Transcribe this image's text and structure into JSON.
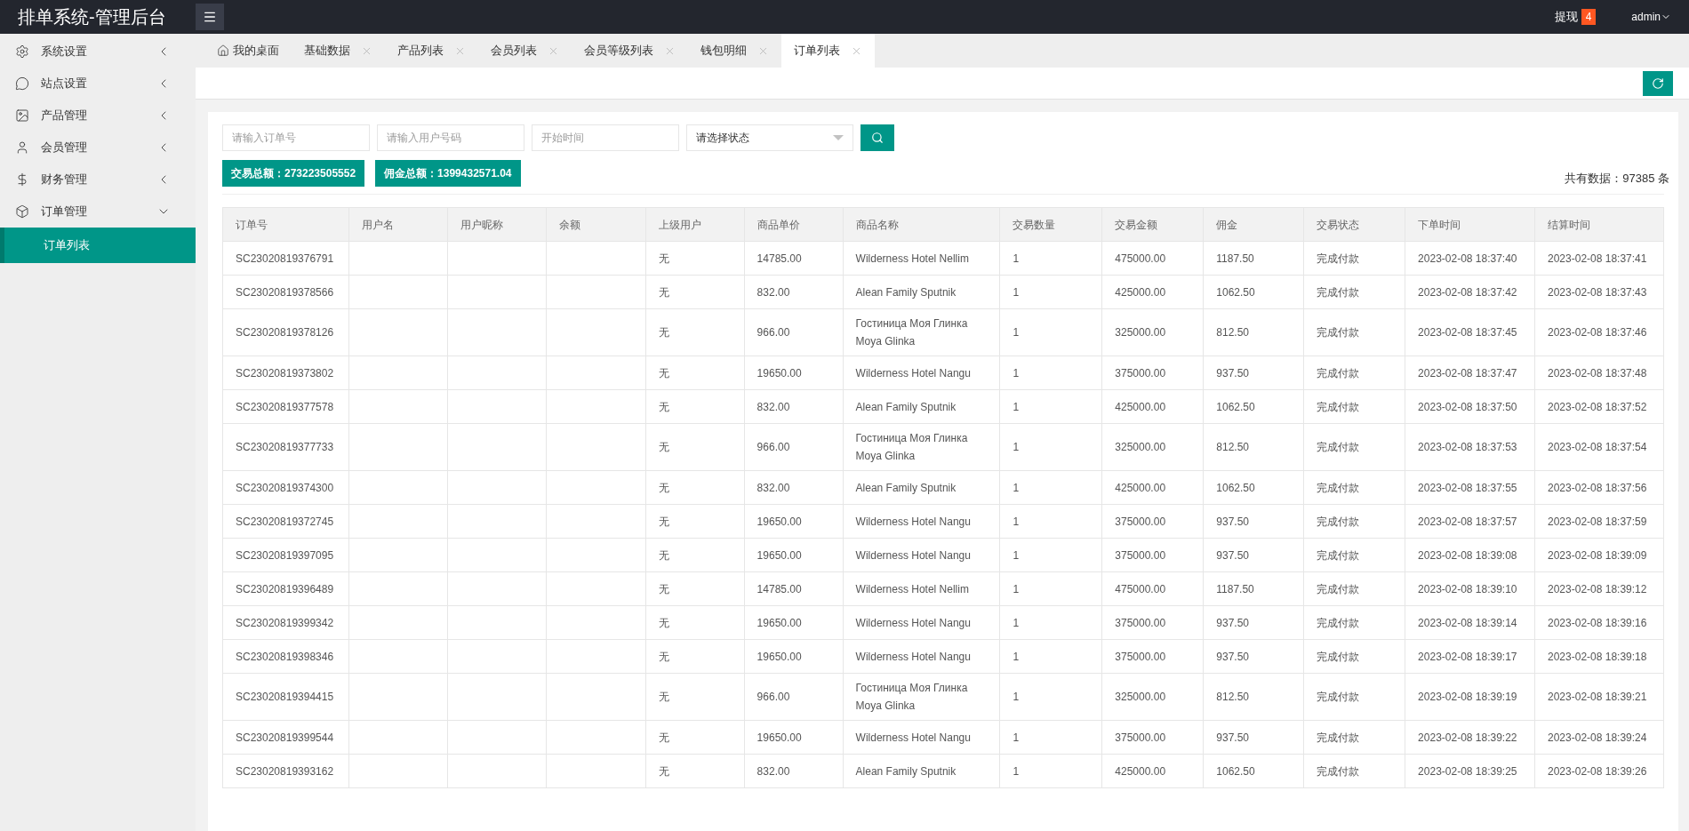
{
  "header": {
    "title": "排单系统-管理后台",
    "withdraw_label": "提现",
    "withdraw_count": "4",
    "user": "admin"
  },
  "sidebar": {
    "items": [
      {
        "label": "系统设置",
        "expanded": false
      },
      {
        "label": "站点设置",
        "expanded": false
      },
      {
        "label": "产品管理",
        "expanded": false
      },
      {
        "label": "会员管理",
        "expanded": false
      },
      {
        "label": "财务管理",
        "expanded": false
      },
      {
        "label": "订单管理",
        "expanded": true,
        "children": [
          {
            "label": "订单列表",
            "selected": true
          }
        ]
      }
    ]
  },
  "tabs": [
    {
      "label": "我的桌面",
      "kind": "home",
      "selected": false
    },
    {
      "label": "基础数据",
      "kind": "closable",
      "selected": false
    },
    {
      "label": "产品列表",
      "kind": "closable",
      "selected": false
    },
    {
      "label": "会员列表",
      "kind": "closable",
      "selected": false
    },
    {
      "label": "会员等级列表",
      "kind": "closable",
      "selected": false
    },
    {
      "label": "钱包明细",
      "kind": "closable",
      "selected": false
    },
    {
      "label": "订单列表",
      "kind": "closable",
      "selected": true
    }
  ],
  "filters": {
    "order_placeholder": "请输入订单号",
    "user_placeholder": "请输入用户号码",
    "date_placeholder": "开始时间",
    "status_value": "请选择状态"
  },
  "summary": {
    "trade_total": "交易总额：273223505552",
    "commission_total": "佣金总额：1399432571.04",
    "count": "共有数据：97385 条"
  },
  "table": {
    "columns": [
      "订单号",
      "用户名",
      "用户昵称",
      "余额",
      "上级用户",
      "商品单价",
      "商品名称",
      "交易数量",
      "交易金额",
      "佣金",
      "交易状态",
      "下单时间",
      "结算时间"
    ],
    "rows": [
      [
        "SC23020819376791",
        "",
        "",
        "",
        "无",
        "14785.00",
        "Wilderness Hotel Nellim",
        "1",
        "475000.00",
        "1187.50",
        "完成付款",
        "2023-02-08 18:37:40",
        "2023-02-08 18:37:41"
      ],
      [
        "SC23020819378566",
        "",
        "",
        "",
        "无",
        "832.00",
        "Alean Family Sputnik",
        "1",
        "425000.00",
        "1062.50",
        "完成付款",
        "2023-02-08 18:37:42",
        "2023-02-08 18:37:43"
      ],
      [
        "SC23020819378126",
        "",
        "",
        "",
        "无",
        "966.00",
        "Гостиница Моя Глинка Moya Glinka",
        "1",
        "325000.00",
        "812.50",
        "完成付款",
        "2023-02-08 18:37:45",
        "2023-02-08 18:37:46"
      ],
      [
        "SC23020819373802",
        "",
        "",
        "",
        "无",
        "19650.00",
        "Wilderness Hotel Nangu",
        "1",
        "375000.00",
        "937.50",
        "完成付款",
        "2023-02-08 18:37:47",
        "2023-02-08 18:37:48"
      ],
      [
        "SC23020819377578",
        "",
        "",
        "",
        "无",
        "832.00",
        "Alean Family Sputnik",
        "1",
        "425000.00",
        "1062.50",
        "完成付款",
        "2023-02-08 18:37:50",
        "2023-02-08 18:37:52"
      ],
      [
        "SC23020819377733",
        "",
        "",
        "",
        "无",
        "966.00",
        "Гостиница Моя Глинка Moya Glinka",
        "1",
        "325000.00",
        "812.50",
        "完成付款",
        "2023-02-08 18:37:53",
        "2023-02-08 18:37:54"
      ],
      [
        "SC23020819374300",
        "",
        "",
        "",
        "无",
        "832.00",
        "Alean Family Sputnik",
        "1",
        "425000.00",
        "1062.50",
        "完成付款",
        "2023-02-08 18:37:55",
        "2023-02-08 18:37:56"
      ],
      [
        "SC23020819372745",
        "",
        "",
        "",
        "无",
        "19650.00",
        "Wilderness Hotel Nangu",
        "1",
        "375000.00",
        "937.50",
        "完成付款",
        "2023-02-08 18:37:57",
        "2023-02-08 18:37:59"
      ],
      [
        "SC23020819397095",
        "",
        "",
        "",
        "无",
        "19650.00",
        "Wilderness Hotel Nangu",
        "1",
        "375000.00",
        "937.50",
        "完成付款",
        "2023-02-08 18:39:08",
        "2023-02-08 18:39:09"
      ],
      [
        "SC23020819396489",
        "",
        "",
        "",
        "无",
        "14785.00",
        "Wilderness Hotel Nellim",
        "1",
        "475000.00",
        "1187.50",
        "完成付款",
        "2023-02-08 18:39:10",
        "2023-02-08 18:39:12"
      ],
      [
        "SC23020819399342",
        "",
        "",
        "",
        "无",
        "19650.00",
        "Wilderness Hotel Nangu",
        "1",
        "375000.00",
        "937.50",
        "完成付款",
        "2023-02-08 18:39:14",
        "2023-02-08 18:39:16"
      ],
      [
        "SC23020819398346",
        "",
        "",
        "",
        "无",
        "19650.00",
        "Wilderness Hotel Nangu",
        "1",
        "375000.00",
        "937.50",
        "完成付款",
        "2023-02-08 18:39:17",
        "2023-02-08 18:39:18"
      ],
      [
        "SC23020819394415",
        "",
        "",
        "",
        "无",
        "966.00",
        "Гостиница Моя Глинка Moya Glinka",
        "1",
        "325000.00",
        "812.50",
        "完成付款",
        "2023-02-08 18:39:19",
        "2023-02-08 18:39:21"
      ],
      [
        "SC23020819399544",
        "",
        "",
        "",
        "无",
        "19650.00",
        "Wilderness Hotel Nangu",
        "1",
        "375000.00",
        "937.50",
        "完成付款",
        "2023-02-08 18:39:22",
        "2023-02-08 18:39:24"
      ],
      [
        "SC23020819393162",
        "",
        "",
        "",
        "无",
        "832.00",
        "Alean Family Sputnik",
        "1",
        "425000.00",
        "1062.50",
        "完成付款",
        "2023-02-08 18:39:25",
        "2023-02-08 18:39:26"
      ]
    ]
  }
}
